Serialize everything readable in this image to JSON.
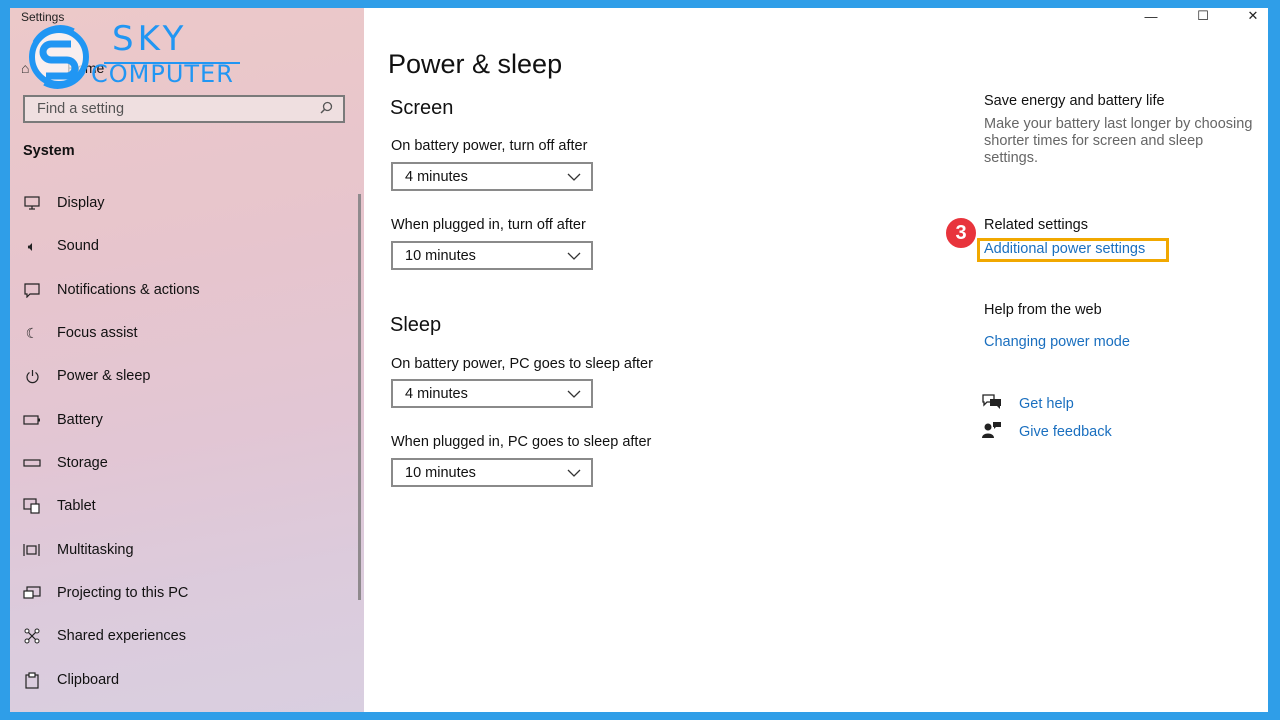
{
  "app": {
    "title": "Settings"
  },
  "window_controls": {
    "minimize": "—",
    "maximize": "☐",
    "close": "✕"
  },
  "watermark": {
    "top": "SKY",
    "bottom": "COMPUTER",
    "brand_color": "#2196f3"
  },
  "sidebar": {
    "home_label": "Home",
    "search_placeholder": "Find a setting",
    "section": "System",
    "items": [
      {
        "label": "Display",
        "icon": "monitor-icon"
      },
      {
        "label": "Sound",
        "icon": "speaker-icon"
      },
      {
        "label": "Notifications & actions",
        "icon": "notification-icon"
      },
      {
        "label": "Focus assist",
        "icon": "moon-icon"
      },
      {
        "label": "Power & sleep",
        "icon": "power-icon"
      },
      {
        "label": "Battery",
        "icon": "battery-icon"
      },
      {
        "label": "Storage",
        "icon": "storage-icon"
      },
      {
        "label": "Tablet",
        "icon": "tablet-icon"
      },
      {
        "label": "Multitasking",
        "icon": "multitasking-icon"
      },
      {
        "label": "Projecting to this PC",
        "icon": "projecting-icon"
      },
      {
        "label": "Shared experiences",
        "icon": "shared-icon"
      },
      {
        "label": "Clipboard",
        "icon": "clipboard-icon"
      }
    ]
  },
  "main": {
    "title": "Power & sleep",
    "screen": {
      "heading": "Screen",
      "battery_label": "On battery power, turn off after",
      "battery_value": "4 minutes",
      "plugged_label": "When plugged in, turn off after",
      "plugged_value": "10 minutes"
    },
    "sleep": {
      "heading": "Sleep",
      "battery_label": "On battery power, PC goes to sleep after",
      "battery_value": "4 minutes",
      "plugged_label": "When plugged in, PC goes to sleep after",
      "plugged_value": "10 minutes"
    }
  },
  "right": {
    "save_heading": "Save energy and battery life",
    "save_desc": "Make your battery last longer by choosing shorter times for screen and sleep settings.",
    "related_heading": "Related settings",
    "related_link": "Additional power settings",
    "step_number": "3",
    "web_heading": "Help from the web",
    "web_link": "Changing power mode",
    "get_help": "Get help",
    "give_feedback": "Give feedback"
  },
  "colors": {
    "link": "#1a6fbf",
    "highlight": "#f1a800",
    "badge": "#e8343c",
    "frame": "#2f9ee8"
  }
}
